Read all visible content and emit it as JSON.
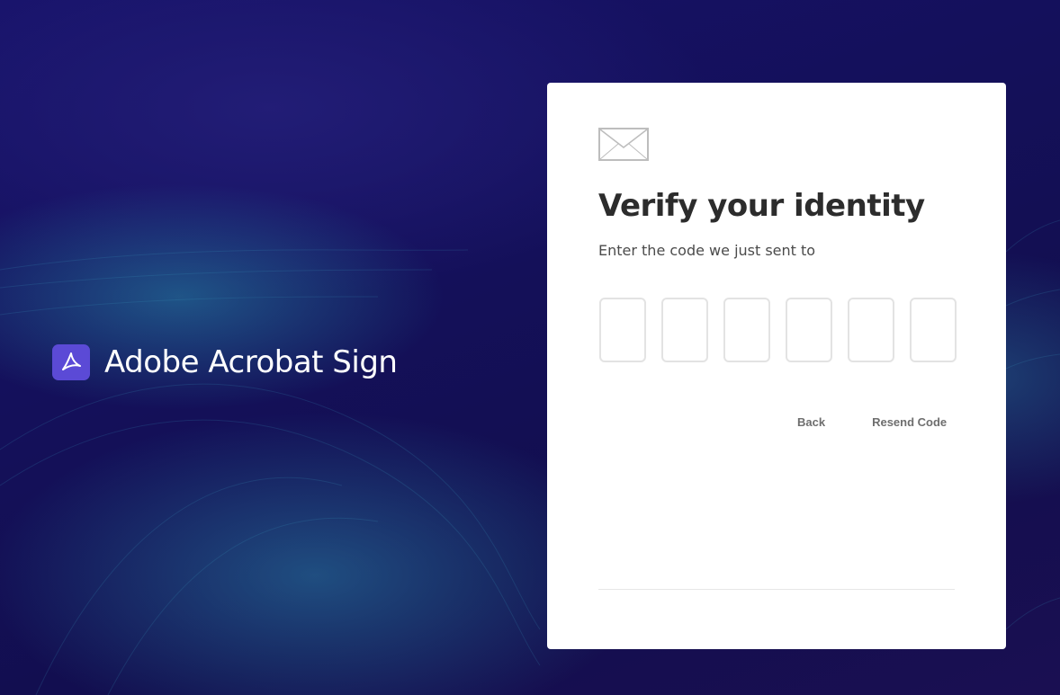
{
  "brand": {
    "name": "Adobe Acrobat Sign",
    "logo_icon": "acrobat-logo-icon",
    "logo_color": "#5b4ad6"
  },
  "card": {
    "icon": "envelope-icon",
    "title": "Verify your identity",
    "subtitle": "Enter the code we just sent to",
    "code_fields": [
      "",
      "",
      "",
      "",
      "",
      ""
    ],
    "back_label": "Back",
    "resend_label": "Resend Code"
  },
  "colors": {
    "background": "#141058",
    "card": "#ffffff",
    "title_text": "#2c2c2c",
    "link_text": "#6e6e6e"
  }
}
